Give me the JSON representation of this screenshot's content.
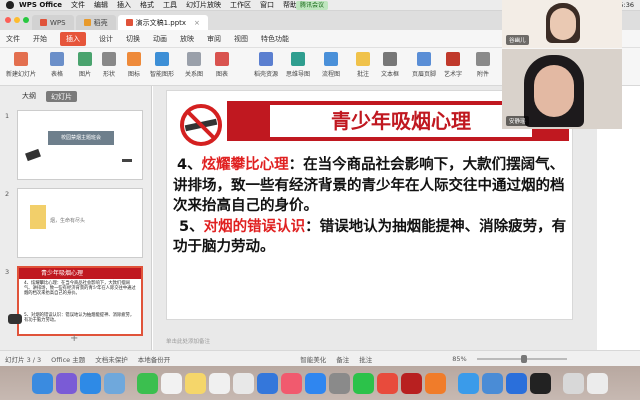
{
  "menubar": {
    "app": "WPS Office",
    "items": [
      "文件",
      "编辑",
      "插入",
      "格式",
      "工具",
      "幻灯片放映",
      "工作区",
      "窗口",
      "帮助"
    ],
    "meeting": "腾讯会议",
    "clock": "周二 15:36"
  },
  "tabs": [
    {
      "label": "WPS",
      "active": false
    },
    {
      "label": "稻壳",
      "active": false
    },
    {
      "label": "演示文稿1.pptx",
      "active": true
    }
  ],
  "ribbon_tabs": [
    "文件",
    "开始",
    "插入",
    "设计",
    "切换",
    "动画",
    "放映",
    "审阅",
    "视图",
    "特色功能"
  ],
  "ribbon_active": "插入",
  "toolbar": [
    "新建幻灯片",
    "表格",
    "图片",
    "形状",
    "图标",
    "智能图形",
    "关系图",
    "图表",
    "稻壳资源",
    "流程图",
    "思维导图",
    "批注",
    "文本框",
    "页眉页脚",
    "艺术字",
    "附件"
  ],
  "panel": {
    "tabs": [
      "大纲",
      "幻灯片"
    ],
    "active": "幻灯片"
  },
  "thumbs": [
    {
      "num": "1",
      "title": "校园禁烟主题班会"
    },
    {
      "num": "2",
      "title": "烟，生命有尽头"
    },
    {
      "num": "3",
      "title": "青少年吸烟心理",
      "line1": "4、炫耀攀比心理：在当今商品社会影响下，大款们摆阔气、讲排场，致一些有经济背景的青少年在人际交往中通过烟的档次来抬高自己的身价。",
      "line2": "5、对烟的错误认识：错误地认为抽烟能提神、消除疲劳，有功于脑力劳动。"
    }
  ],
  "slide": {
    "title": "青少年吸烟心理",
    "p1_num": "4、",
    "p1_head": "炫耀攀比心理",
    "p1_colon": "：",
    "p1_text": "在当今商品社会影响下，大款们摆阔气、讲排场，致一些有经济背景的青少年在人际交往中通过烟的档次来抬高自己的身价。",
    "p2_num": "5、",
    "p2_head": "对烟的错误认识",
    "p2_colon": "：",
    "p2_text": "错误地认为抽烟能提神、消除疲劳，有功于脑力劳动。"
  },
  "notes": "单击此处添加备注",
  "status": {
    "slide": "幻灯片 3 / 3",
    "theme": "Office 主题",
    "protect": "文档未保护",
    "backup": "本地备份开",
    "beautify": "智能美化",
    "notes": "备注",
    "comment": "批注",
    "zoom": "85%"
  },
  "video": [
    {
      "name": "谷幽儿"
    },
    {
      "name": "安静瑶"
    }
  ],
  "colors": {
    "accent": "#e6553a",
    "slide_red": "#e02020",
    "title_red": "#c01820",
    "dock": "#c0b0a8"
  }
}
